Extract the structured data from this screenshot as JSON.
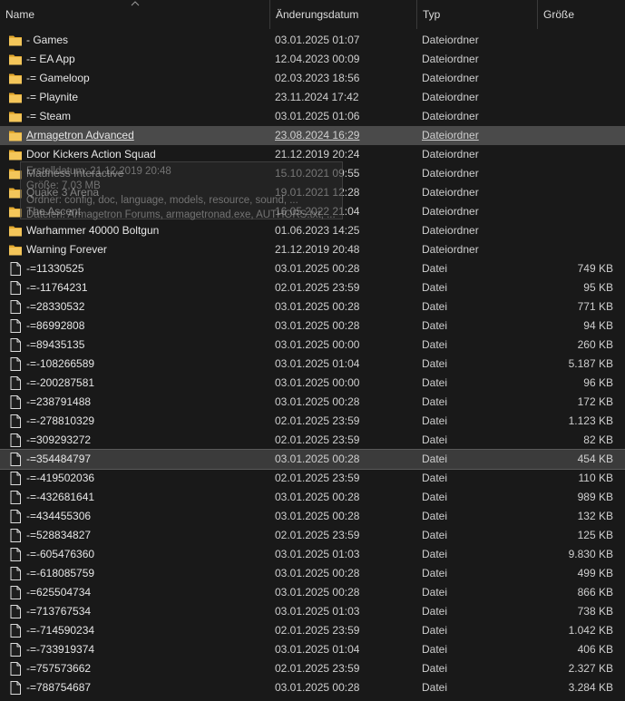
{
  "columns": {
    "name": "Name",
    "date": "Änderungsdatum",
    "type": "Typ",
    "size": "Größe"
  },
  "rows": [
    {
      "name": "- Games",
      "date": "03.01.2025 01:07",
      "type": "Dateiordner",
      "size": "",
      "icon": "folder-icon"
    },
    {
      "name": "-= EA App",
      "date": "12.04.2023 00:09",
      "type": "Dateiordner",
      "size": "",
      "icon": "folder-icon"
    },
    {
      "name": "-= Gameloop",
      "date": "02.03.2023 18:56",
      "type": "Dateiordner",
      "size": "",
      "icon": "folder-icon"
    },
    {
      "name": "-= Playnite",
      "date": "23.11.2024 17:42",
      "type": "Dateiordner",
      "size": "",
      "icon": "folder-icon"
    },
    {
      "name": "-= Steam",
      "date": "03.01.2025 01:06",
      "type": "Dateiordner",
      "size": "",
      "icon": "folder-icon"
    },
    {
      "name": "Armagetron Advanced",
      "date": "23.08.2024 16:29",
      "type": "Dateiordner",
      "size": "",
      "icon": "folder-icon",
      "state": "hover"
    },
    {
      "name": "Door Kickers Action Squad",
      "date": "21.12.2019 20:24",
      "type": "Dateiordner",
      "size": "",
      "icon": "folder-icon"
    },
    {
      "name": "Madness Interactive",
      "date": "15.10.2021 09:55",
      "type": "Dateiordner",
      "size": "",
      "icon": "folder-icon"
    },
    {
      "name": "Quake 3 Arena",
      "date": "19.01.2021 12:28",
      "type": "Dateiordner",
      "size": "",
      "icon": "folder-icon"
    },
    {
      "name": "The Ascent",
      "date": "16.05.2022 21:04",
      "type": "Dateiordner",
      "size": "",
      "icon": "folder-icon"
    },
    {
      "name": "Warhammer 40000 Boltgun",
      "date": "01.06.2023 14:25",
      "type": "Dateiordner",
      "size": "",
      "icon": "folder-icon"
    },
    {
      "name": "Warning Forever",
      "date": "21.12.2019 20:48",
      "type": "Dateiordner",
      "size": "",
      "icon": "folder-icon"
    },
    {
      "name": "-=11330525",
      "date": "03.01.2025 00:28",
      "type": "Datei",
      "size": "749 KB",
      "icon": "file-icon"
    },
    {
      "name": "-=-11764231",
      "date": "02.01.2025 23:59",
      "type": "Datei",
      "size": "95 KB",
      "icon": "file-icon"
    },
    {
      "name": "-=28330532",
      "date": "03.01.2025 00:28",
      "type": "Datei",
      "size": "771 KB",
      "icon": "file-icon"
    },
    {
      "name": "-=86992808",
      "date": "03.01.2025 00:28",
      "type": "Datei",
      "size": "94 KB",
      "icon": "file-icon"
    },
    {
      "name": "-=89435135",
      "date": "03.01.2025 00:00",
      "type": "Datei",
      "size": "260 KB",
      "icon": "file-icon"
    },
    {
      "name": "-=-108266589",
      "date": "03.01.2025 01:04",
      "type": "Datei",
      "size": "5.187 KB",
      "icon": "file-icon"
    },
    {
      "name": "-=-200287581",
      "date": "03.01.2025 00:00",
      "type": "Datei",
      "size": "96 KB",
      "icon": "file-icon"
    },
    {
      "name": "-=238791488",
      "date": "03.01.2025 00:28",
      "type": "Datei",
      "size": "172 KB",
      "icon": "file-icon"
    },
    {
      "name": "-=-278810329",
      "date": "02.01.2025 23:59",
      "type": "Datei",
      "size": "1.123 KB",
      "icon": "file-icon"
    },
    {
      "name": "-=309293272",
      "date": "02.01.2025 23:59",
      "type": "Datei",
      "size": "82 KB",
      "icon": "file-icon"
    },
    {
      "name": "-=354484797",
      "date": "03.01.2025 00:28",
      "type": "Datei",
      "size": "454 KB",
      "icon": "file-icon",
      "state": "selected"
    },
    {
      "name": "-=-419502036",
      "date": "02.01.2025 23:59",
      "type": "Datei",
      "size": "110 KB",
      "icon": "file-icon"
    },
    {
      "name": "-=-432681641",
      "date": "03.01.2025 00:28",
      "type": "Datei",
      "size": "989 KB",
      "icon": "file-icon"
    },
    {
      "name": "-=434455306",
      "date": "03.01.2025 00:28",
      "type": "Datei",
      "size": "132 KB",
      "icon": "file-icon"
    },
    {
      "name": "-=528834827",
      "date": "02.01.2025 23:59",
      "type": "Datei",
      "size": "125 KB",
      "icon": "file-icon"
    },
    {
      "name": "-=-605476360",
      "date": "03.01.2025 01:03",
      "type": "Datei",
      "size": "9.830 KB",
      "icon": "file-icon"
    },
    {
      "name": "-=-618085759",
      "date": "03.01.2025 00:28",
      "type": "Datei",
      "size": "499 KB",
      "icon": "file-icon"
    },
    {
      "name": "-=625504734",
      "date": "03.01.2025 00:28",
      "type": "Datei",
      "size": "866 KB",
      "icon": "file-icon"
    },
    {
      "name": "-=713767534",
      "date": "03.01.2025 01:03",
      "type": "Datei",
      "size": "738 KB",
      "icon": "file-icon"
    },
    {
      "name": "-=-714590234",
      "date": "02.01.2025 23:59",
      "type": "Datei",
      "size": "1.042 KB",
      "icon": "file-icon"
    },
    {
      "name": "-=-733919374",
      "date": "03.01.2025 01:04",
      "type": "Datei",
      "size": "406 KB",
      "icon": "file-icon"
    },
    {
      "name": "-=757573662",
      "date": "02.01.2025 23:59",
      "type": "Datei",
      "size": "2.327 KB",
      "icon": "file-icon"
    },
    {
      "name": "-=788754687",
      "date": "03.01.2025 00:28",
      "type": "Datei",
      "size": "3.284 KB",
      "icon": "file-icon"
    }
  ],
  "tooltip": {
    "lines": [
      "Erstelldatum: 21.12.2019 20:48",
      "Größe: 7,03 MB",
      "Ordner: config, doc, language, models, resource, sound, ...",
      "Dateien: Armagetron Forums, armagetronad.exe, AUTHORS.txt, ..."
    ]
  },
  "colors": {
    "background": "#191919",
    "folder": "#f4c65a",
    "hover": "#4a4a4a"
  }
}
